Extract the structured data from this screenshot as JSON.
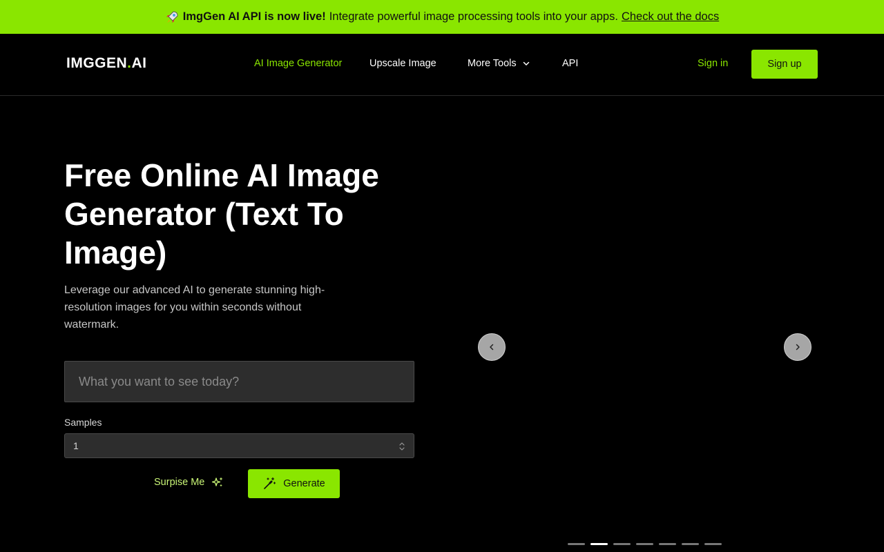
{
  "banner": {
    "emoji_icon": "rocket-icon",
    "headline": "ImgGen AI API is now live!",
    "message": "Integrate powerful image processing tools into your apps.",
    "link_text": "Check out the docs",
    "bg_color": "#8ae600"
  },
  "header": {
    "logo_main": "IMGGEN",
    "logo_dot": ".",
    "logo_suffix": "AI",
    "nav": [
      {
        "label": "AI Image Generator",
        "active": true
      },
      {
        "label": "Upscale Image"
      },
      {
        "label": "More Tools",
        "icon": "chevron-down-icon"
      },
      {
        "label": "API"
      }
    ],
    "signin_label": "Sign in",
    "signup_label": "Sign up"
  },
  "hero": {
    "title": "Free Online AI Image Generator (Text To Image)",
    "subtitle": "Leverage our advanced AI to generate stunning high-resolution images for you within seconds without watermark.",
    "prompt_placeholder": "What you want to see today?",
    "samples_label": "Samples",
    "samples_value": "1",
    "surprise_label": "Surpise Me",
    "generate_label": "Generate"
  },
  "carousel": {
    "prev_icon": "chevron-left-icon",
    "next_icon": "chevron-right-icon",
    "slide_count": 7,
    "active_index": 1
  },
  "colors": {
    "accent": "#8ae600",
    "background": "#000000",
    "input_bg": "#2d2d2d"
  }
}
